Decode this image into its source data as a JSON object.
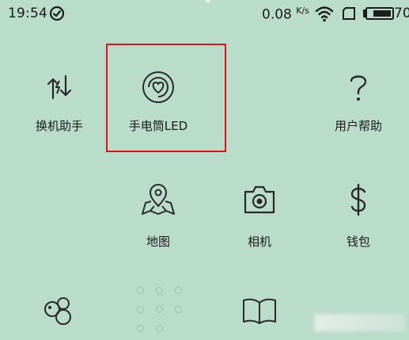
{
  "status_bar": {
    "time": "19:54",
    "speed": "0.08",
    "speed_unit": "K/s",
    "battery": "70"
  },
  "apps": [
    {
      "label": "换机助手",
      "icon": "phone-transfer-icon"
    },
    {
      "label": "手电筒LED",
      "icon": "flashlight-heart-icon"
    },
    {
      "label": "用户帮助",
      "icon": "question-mark-icon"
    },
    {
      "label": "地图",
      "icon": "map-pin-icon"
    },
    {
      "label": "相机",
      "icon": "camera-icon"
    },
    {
      "label": "钱包",
      "icon": "dollar-icon"
    }
  ],
  "colors": {
    "background": "#b9dccb",
    "highlight": "#e0101c"
  }
}
